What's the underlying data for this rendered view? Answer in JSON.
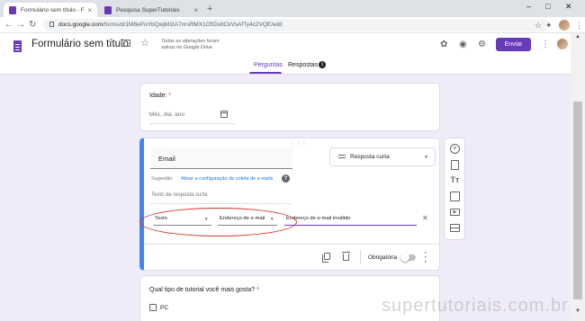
{
  "browser": {
    "tabs": [
      {
        "title": "Formulário sem título - Formulár",
        "favicon_color": "#673ab7",
        "active": true
      },
      {
        "title": "Pesquisa SuperTutoriais",
        "favicon_color": "#673ab7",
        "active": false
      }
    ],
    "url_host": "docs.google.com",
    "url_path": "/forms/d/1M8ePoYbQwjM1tA7nrsRMX1O5DxltCkVsAfTy4c2VQE/edit",
    "window_controls": {
      "minimize": "–",
      "maximize": "□",
      "close": "✕"
    }
  },
  "form_header": {
    "title": "Formulário sem título",
    "saved_status": "Todas as alterações foram salvas no Google Drive",
    "send_label": "Enviar",
    "tabs": {
      "questions": "Perguntas",
      "responses": "Respostas",
      "responses_count": "1"
    }
  },
  "questions": {
    "idade": {
      "label": "Idade:",
      "required_mark": "*",
      "placeholder": "Mês, dia, ano"
    },
    "email": {
      "title": "Email",
      "type": "Resposta curta",
      "suggestion_prefix": "Sugestão:",
      "suggestion_link": "Ativar a configuração de coleta de e-mails",
      "answer_placeholder": "Texto de resposta curta",
      "validation_type": "Texto",
      "validation_rule": "Endereço de e-mail",
      "error_text": "Endereço de e-mail inválido",
      "required_label": "Obrigatória",
      "required_on": false
    },
    "tutorial": {
      "label": "Qual tipo de tutorial você mais gosta?",
      "required_mark": "*",
      "option_1": "PC"
    }
  },
  "icons": {
    "menu": "⋮",
    "help": "?",
    "clear": "✕",
    "drag": "⋮⋮⋮"
  },
  "colors": {
    "accent": "#673ab7",
    "active_card": "#4285f4",
    "required": "#d93025",
    "annotation": "#d93025"
  },
  "watermark": "supertutoriais.com.br"
}
